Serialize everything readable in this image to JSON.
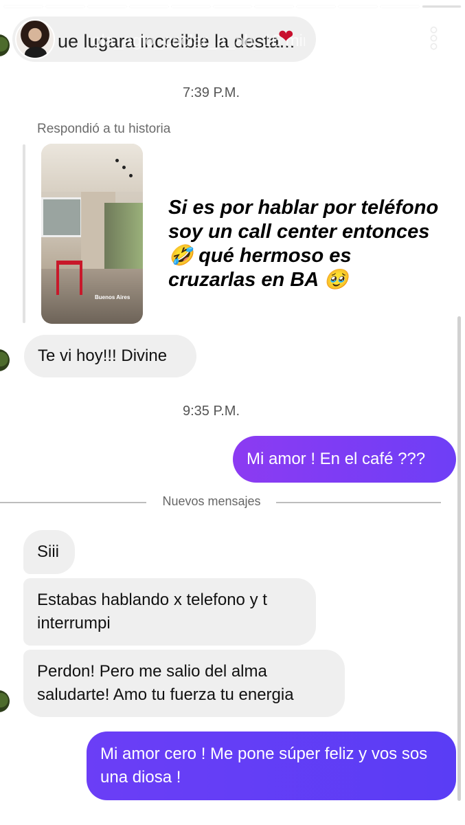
{
  "header": {
    "preview_text": "ue lugara increible la desta...",
    "overlay_text": "ola_aglo_caclar_a_ab_16 min",
    "more_label": "more options"
  },
  "messages": [
    {
      "type": "timestamp",
      "text": "7:39 P.M."
    },
    {
      "type": "story_reply",
      "label": "Respondió a tu historia",
      "story_caption": "Buenos Aires",
      "reply_text": "Si es por hablar por teléfono soy un call center entonces 🤣 qué hermoso es cruzarlas en BA 🥹"
    },
    {
      "type": "incoming",
      "text": "Te vi hoy!!! Divine"
    },
    {
      "type": "timestamp",
      "text": "9:35 P.M."
    },
    {
      "type": "outgoing",
      "text": "Mi amor ! En el café ???"
    },
    {
      "type": "divider",
      "text": "Nuevos mensajes"
    },
    {
      "type": "incoming",
      "text": "Siii"
    },
    {
      "type": "incoming",
      "text": "Estabas hablando x telefono y t interrumpi"
    },
    {
      "type": "incoming",
      "text": "Perdon! Pero me salio del alma saludarte! Amo tu fuerza tu energia"
    },
    {
      "type": "outgoing",
      "text": "Mi amor cero ! Me pone súper feliz y vos sos una diosa !"
    }
  ],
  "colors": {
    "outgoing_start": "#8a3bf0",
    "outgoing_end": "#5b3df5",
    "incoming_bg": "#efefef"
  }
}
